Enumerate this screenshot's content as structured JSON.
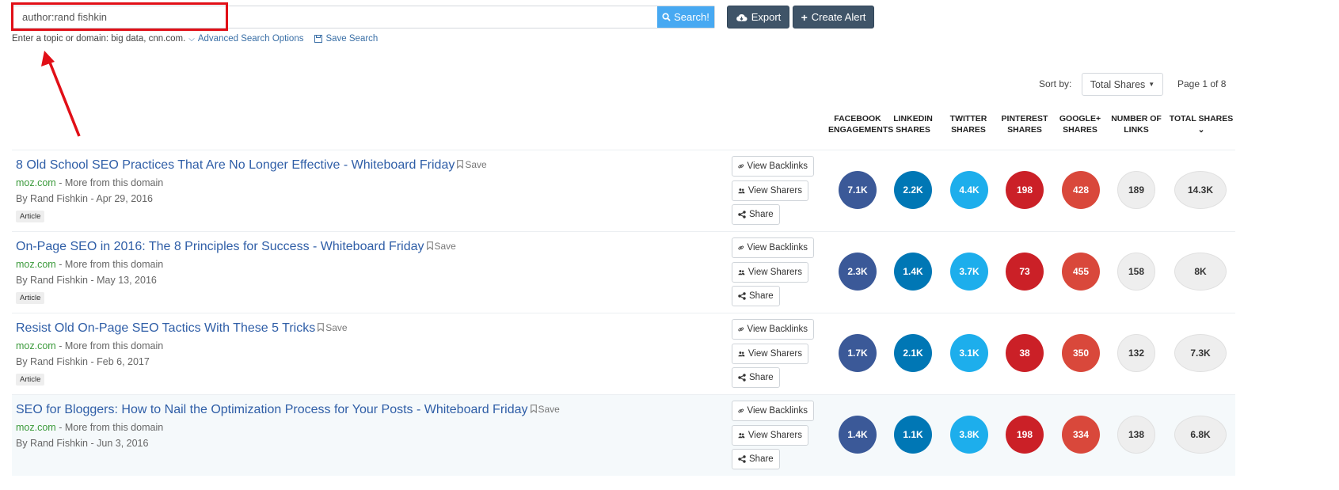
{
  "search": {
    "value": "author:rand fishkin",
    "button_label": "Search!",
    "hint": "Enter a topic or domain: big data, cnn.com.",
    "advanced_label": "Advanced Search Options",
    "save_search_label": "Save Search"
  },
  "toolbar": {
    "export_label": "Export",
    "create_alert_label": "Create Alert"
  },
  "sort": {
    "label": "Sort by:",
    "selected": "Total Shares",
    "page_info": "Page 1 of 8"
  },
  "columns": [
    {
      "line1": "Facebook",
      "line2": "Engagements"
    },
    {
      "line1": "Linkedin",
      "line2": "Shares"
    },
    {
      "line1": "Twitter",
      "line2": "Shares"
    },
    {
      "line1": "Pinterest",
      "line2": "Shares"
    },
    {
      "line1": "Google+",
      "line2": "Shares"
    },
    {
      "line1": "Number of",
      "line2": "Links"
    },
    {
      "line1": "Total Shares",
      "line2": ""
    }
  ],
  "row_buttons": {
    "backlinks": "View Backlinks",
    "sharers": "View Sharers",
    "share": "Share",
    "save": "Save",
    "more_from_domain": "- More from this domain"
  },
  "colors": {
    "facebook": "#3b5998",
    "linkedin": "#0077b5",
    "twitter": "#1daeec",
    "pinterest": "#cb2027",
    "google": "#d9483b",
    "search_button": "#47a9f2",
    "dark_button": "#3f5468",
    "highlight": "#e10f17"
  },
  "results": [
    {
      "title": "8 Old School SEO Practices That Are No Longer Effective - Whiteboard Friday",
      "domain": "moz.com",
      "byline": "By Rand Fishkin - Apr 29, 2016",
      "tag": "Article",
      "facebook": "7.1K",
      "linkedin": "2.2K",
      "twitter": "4.4K",
      "pinterest": "198",
      "google": "428",
      "links": "189",
      "total": "14.3K"
    },
    {
      "title": "On-Page SEO in 2016: The 8 Principles for Success - Whiteboard Friday",
      "domain": "moz.com",
      "byline": "By Rand Fishkin - May 13, 2016",
      "tag": "Article",
      "facebook": "2.3K",
      "linkedin": "1.4K",
      "twitter": "3.7K",
      "pinterest": "73",
      "google": "455",
      "links": "158",
      "total": "8K"
    },
    {
      "title": "Resist Old On-Page SEO Tactics With These 5 Tricks",
      "domain": "moz.com",
      "byline": "By Rand Fishkin - Feb 6, 2017",
      "tag": "Article",
      "facebook": "1.7K",
      "linkedin": "2.1K",
      "twitter": "3.1K",
      "pinterest": "38",
      "google": "350",
      "links": "132",
      "total": "7.3K"
    },
    {
      "title": "SEO for Bloggers: How to Nail the Optimization Process for Your Posts - Whiteboard Friday",
      "domain": "moz.com",
      "byline": "By Rand Fishkin - Jun 3, 2016",
      "tag": "",
      "facebook": "1.4K",
      "linkedin": "1.1K",
      "twitter": "3.8K",
      "pinterest": "198",
      "google": "334",
      "links": "138",
      "total": "6.8K"
    }
  ]
}
